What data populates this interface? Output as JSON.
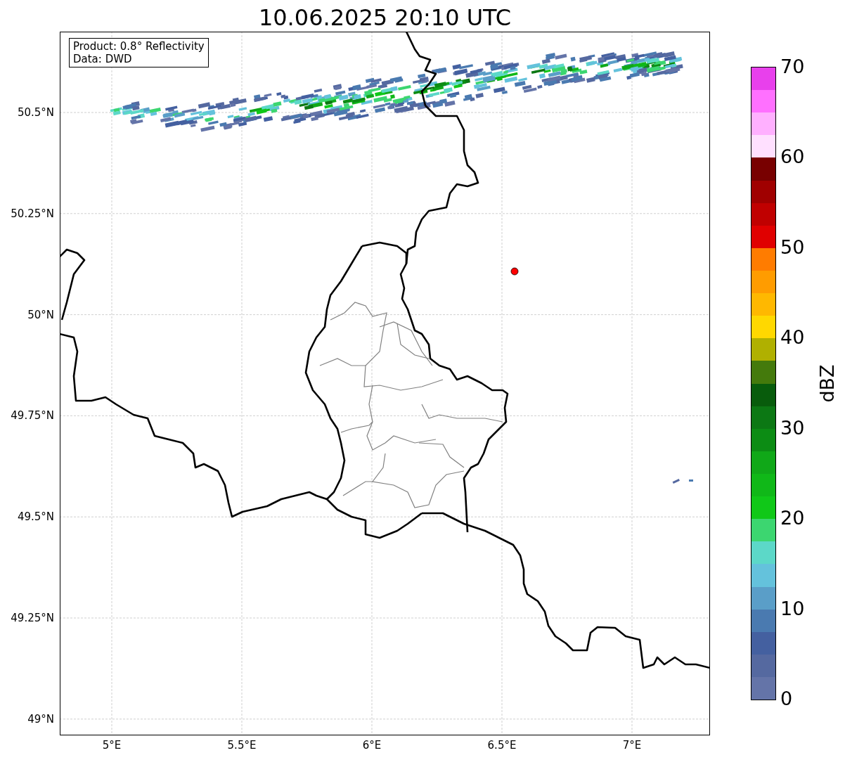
{
  "title": "10.06.2025 20:10 UTC",
  "legend": [
    "Product: 0.8° Reflectivity",
    "Data: DWD"
  ],
  "map": {
    "x_ticks": [
      "5°E",
      "5.5°E",
      "6°E",
      "6.5°E",
      "7°E"
    ],
    "y_ticks": [
      "50.5°N",
      "50.25°N",
      "50°N",
      "49.75°N",
      "49.5°N",
      "49.25°N",
      "49°N"
    ]
  },
  "colorbar": {
    "label": "dBZ",
    "ticks": [
      "70",
      "60",
      "50",
      "40",
      "30",
      "20",
      "10",
      "0"
    ],
    "bins": [
      {
        "color": "#e840ec"
      },
      {
        "color": "#ff70ff"
      },
      {
        "color": "#ffb0ff"
      },
      {
        "color": "#ffe0ff"
      },
      {
        "color": "#780000"
      },
      {
        "color": "#a00000"
      },
      {
        "color": "#c00000"
      },
      {
        "color": "#e00000"
      },
      {
        "color": "#ff7c00"
      },
      {
        "color": "#ff9c00"
      },
      {
        "color": "#ffb800"
      },
      {
        "color": "#ffd800"
      },
      {
        "color": "#b0b000"
      },
      {
        "color": "#447a0c"
      },
      {
        "color": "#085c0c"
      },
      {
        "color": "#0c7814"
      },
      {
        "color": "#0c8c14"
      },
      {
        "color": "#10a818"
      },
      {
        "color": "#10b818"
      },
      {
        "color": "#10c818"
      },
      {
        "color": "#3cd670"
      },
      {
        "color": "#5cd8c8"
      },
      {
        "color": "#64c2dc"
      },
      {
        "color": "#5a9ec8"
      },
      {
        "color": "#4a7ab0"
      },
      {
        "color": "#4460a0"
      },
      {
        "color": "#5569a0"
      },
      {
        "color": "#6474a8"
      }
    ]
  }
}
